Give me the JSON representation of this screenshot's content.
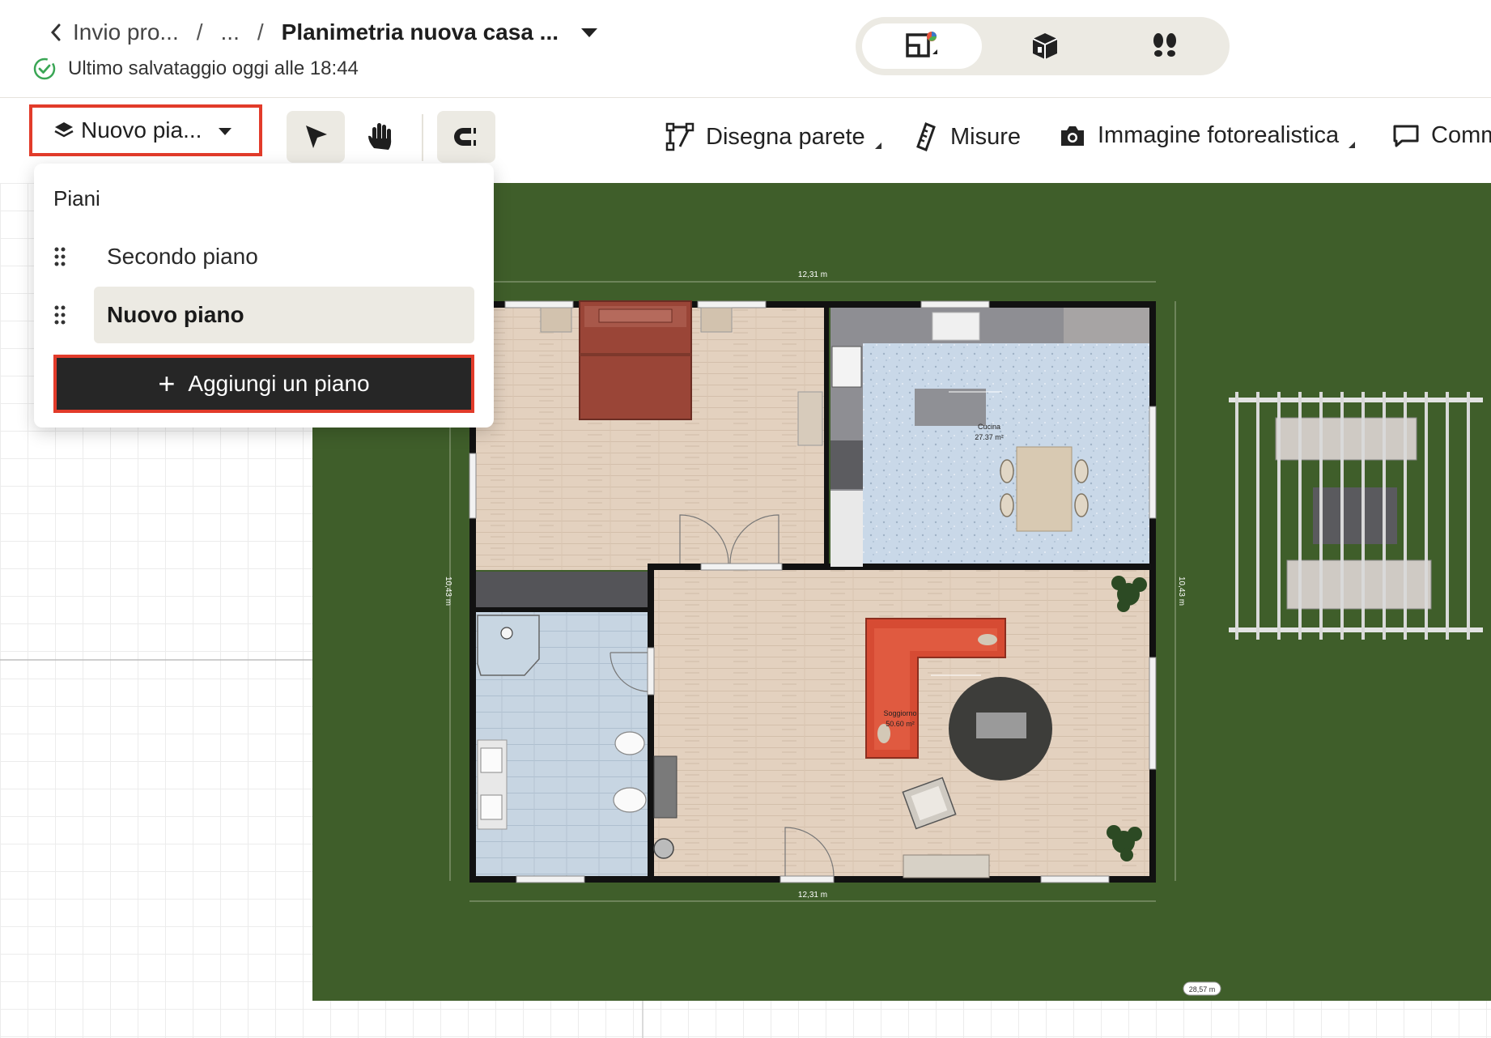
{
  "breadcrumb": {
    "first": "Invio pro...",
    "middle": "...",
    "title": "Planimetria nuova casa ...",
    "separator": "/"
  },
  "save_status": "Ultimo salvataggio oggi alle 18:44",
  "view_switch": {
    "items": [
      "view-2d-icon",
      "view-3d-icon",
      "walkthrough-icon"
    ],
    "active": "view-2d-icon"
  },
  "toolbar": {
    "floor_select_label": "Nuovo pia...",
    "draw_wall": "Disegna parete",
    "measures": "Misure",
    "photo": "Immagine fotorealistica",
    "comment": "Comm"
  },
  "floors_panel": {
    "title": "Piani",
    "floors": [
      {
        "label": "Secondo piano",
        "selected": false
      },
      {
        "label": "Nuovo piano",
        "selected": true
      }
    ],
    "add_button": "Aggiungi un piano"
  },
  "plan": {
    "dim_top": "12,31 m",
    "dim_bottom": "12,31 m",
    "dim_left": "10,43 m",
    "dim_right": "10,43 m",
    "scale": "28,57 m",
    "rooms": [
      {
        "name": "Cucina",
        "area": "27.37 m²"
      },
      {
        "name": "Soggiorno",
        "area": "50.60 m²"
      }
    ]
  },
  "colors": {
    "accent_red": "#e23b2a",
    "grass": "#3f5e2a",
    "wood_floor": "#e2cfbd",
    "tile_floor": "#c9d6e2",
    "dark_button": "#262626",
    "success_green": "#3aa655"
  }
}
